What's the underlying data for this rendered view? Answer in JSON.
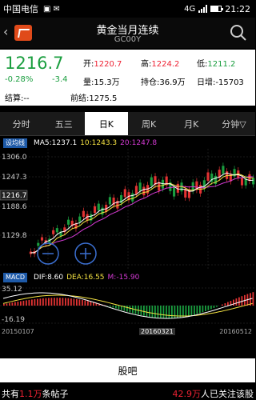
{
  "status": {
    "carrier": "中国电信",
    "net": "4G",
    "time": "21:22"
  },
  "header": {
    "title": "黄金当月连续",
    "code": "GC00Y"
  },
  "quote": {
    "price": "1216.7",
    "change_pct": "-0.28%",
    "change": "-3.4",
    "open_label": "开:",
    "open": "1220.7",
    "high_label": "高:",
    "high": "1224.2",
    "low_label": "低:",
    "low": "1211.2",
    "volume_label": "量:",
    "volume": "15.3万",
    "oi_label": "持仓:",
    "oi": "36.9万",
    "daily_inc_label": "日增:",
    "daily_inc": "-15703",
    "settle_label": "结算:",
    "settle": "--",
    "prev_label": "前结:",
    "prev": "1275.5"
  },
  "tabs": [
    "分时",
    "五三",
    "日K",
    "周K",
    "月K",
    "分钟▽"
  ],
  "active_tab": 2,
  "indicators": {
    "button": "设均线",
    "ma5": "MA5:1237.1",
    "ma10": "10:1243.3",
    "ma20": "20:1247.8"
  },
  "axis": {
    "y_top": "1306.0",
    "y_mid": "1247.3",
    "y_cur": "1216.7",
    "y_low": "1188.6",
    "y_bot": "1129.8"
  },
  "macd": {
    "button": "MACD",
    "dif": "DIF:8.60",
    "dea": "DEA:16.55",
    "m": "M:-15.90",
    "y_top": "35.12",
    "y_bot": "-16.19"
  },
  "dates": [
    "20150107",
    "20160321",
    "20160512"
  ],
  "action_button": "股吧",
  "footer": {
    "posts_pre": "共有",
    "posts_num": "1.1万",
    "posts_post": "条帖子",
    "follow_num": "42.9万",
    "follow_post": "人已关注该股"
  },
  "colors": {
    "up": "#e23333",
    "down": "#1a9e3f",
    "ma5": "#ffffff",
    "ma10": "#f4e242",
    "ma20": "#d43ad4"
  }
}
